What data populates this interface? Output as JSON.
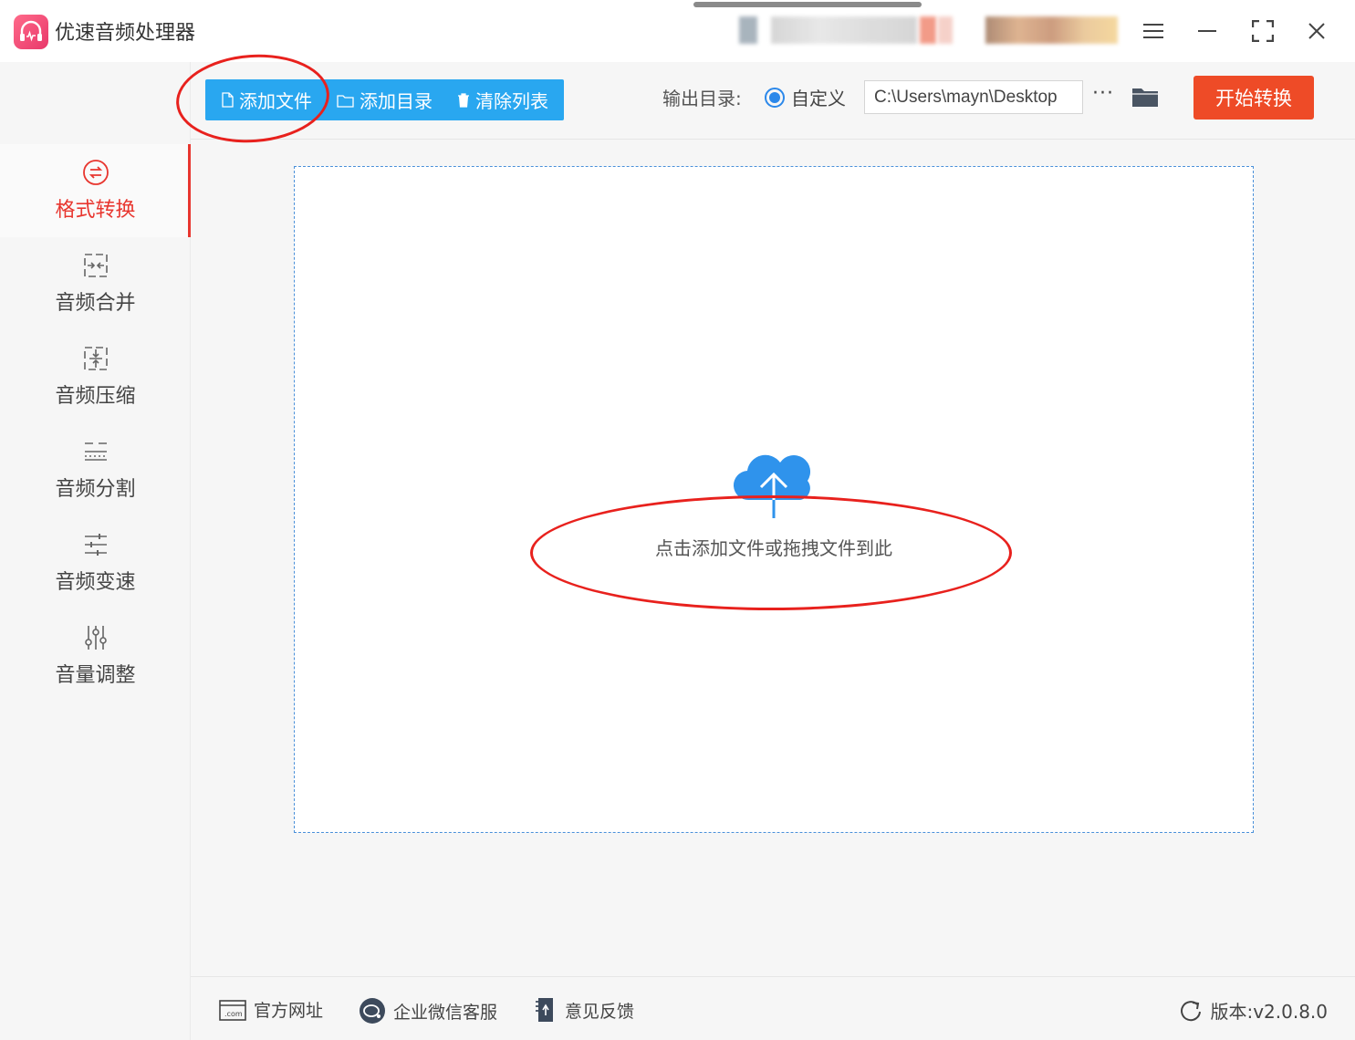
{
  "app": {
    "title": "优速音频处理器"
  },
  "sidebar": {
    "items": [
      {
        "label": "格式转换",
        "icon": "convert-icon",
        "active": true
      },
      {
        "label": "音频合并",
        "icon": "merge-icon",
        "active": false
      },
      {
        "label": "音频压缩",
        "icon": "compress-icon",
        "active": false
      },
      {
        "label": "音频分割",
        "icon": "split-icon",
        "active": false
      },
      {
        "label": "音频变速",
        "icon": "speed-icon",
        "active": false
      },
      {
        "label": "音量调整",
        "icon": "volume-icon",
        "active": false
      }
    ]
  },
  "toolbar": {
    "add_file": "添加文件",
    "add_folder": "添加目录",
    "clear_list": "清除列表",
    "output_label": "输出目录:",
    "custom_option": "自定义",
    "output_path": "C:\\Users\\mayn\\Desktop",
    "more": "···",
    "start": "开始转换"
  },
  "dropzone": {
    "hint": "点击添加文件或拖拽文件到此"
  },
  "footer": {
    "website": "官方网址",
    "wechat": "企业微信客服",
    "feedback": "意见反馈",
    "version": "版本:v2.0.8.0"
  },
  "colors": {
    "accent_blue": "#29a7f0",
    "start_red": "#ee4b27",
    "active_red": "#e8362f",
    "annotation_red": "#e8211d"
  }
}
